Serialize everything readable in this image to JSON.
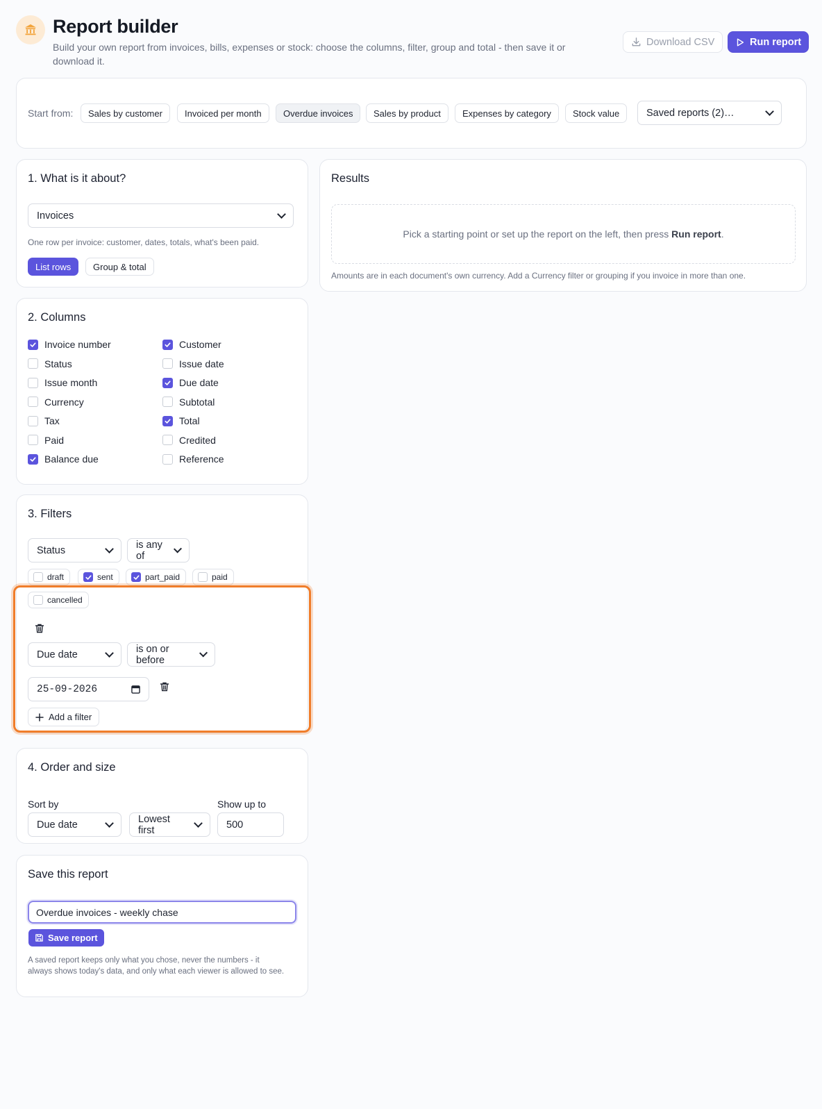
{
  "header": {
    "title": "Report builder",
    "subtitle": "Build your own report from invoices, bills, expenses or stock: choose the columns, filter, group and total - then save it or download it.",
    "download_label": "Download CSV",
    "run_label": "Run report",
    "logo_icon": "bank-icon",
    "accent": "#5b54dd"
  },
  "start": {
    "label": "Start from:",
    "presets": [
      "Sales by customer",
      "Invoiced per month",
      "Overdue invoices",
      "Sales by product",
      "Expenses by category",
      "Stock value"
    ],
    "active_preset": "Overdue invoices",
    "saved_reports": "Saved reports (2)…"
  },
  "about": {
    "title": "1. What is it about?",
    "source": "Invoices",
    "description": "One row per invoice: customer, dates, totals, what's been paid.",
    "mode_list": "List rows",
    "mode_group": "Group & total",
    "mode_selected": "List rows"
  },
  "results": {
    "title": "Results",
    "empty_prefix": "Pick a starting point or set up the report on the left, then press ",
    "empty_strong": "Run report",
    "empty_suffix": ".",
    "note": "Amounts are in each document's own currency. Add a Currency filter or grouping if you invoice in more than one."
  },
  "columns": {
    "title": "2. Columns",
    "items": [
      {
        "label": "Invoice number",
        "checked": true
      },
      {
        "label": "Customer",
        "checked": true
      },
      {
        "label": "Status",
        "checked": false
      },
      {
        "label": "Issue date",
        "checked": false
      },
      {
        "label": "Issue month",
        "checked": false
      },
      {
        "label": "Due date",
        "checked": true
      },
      {
        "label": "Currency",
        "checked": false
      },
      {
        "label": "Subtotal",
        "checked": false
      },
      {
        "label": "Tax",
        "checked": false
      },
      {
        "label": "Total",
        "checked": true
      },
      {
        "label": "Paid",
        "checked": false
      },
      {
        "label": "Credited",
        "checked": false
      },
      {
        "label": "Balance due",
        "checked": true
      },
      {
        "label": "Reference",
        "checked": false
      }
    ]
  },
  "filters": {
    "title": "3. Filters",
    "filter1": {
      "field": "Status",
      "operator": "is any of",
      "options": [
        {
          "label": "draft",
          "checked": false
        },
        {
          "label": "sent",
          "checked": true
        },
        {
          "label": "part_paid",
          "checked": true
        },
        {
          "label": "paid",
          "checked": false
        },
        {
          "label": "cancelled",
          "checked": false
        }
      ]
    },
    "filter2": {
      "field": "Due date",
      "operator": "is on or before",
      "value": "25-09-2026"
    },
    "add_label": "Add a filter"
  },
  "order": {
    "title": "4. Order and size",
    "sort_label": "Sort by",
    "sort_field": "Due date",
    "sort_dir": "Lowest first",
    "limit_label": "Show up to",
    "limit": "500"
  },
  "save": {
    "title": "Save this report",
    "name": "Overdue invoices - weekly chase",
    "button": "Save report",
    "note": "A saved report keeps only what you chose, never the numbers - it always shows today's data, and only what each viewer is allowed to see."
  }
}
